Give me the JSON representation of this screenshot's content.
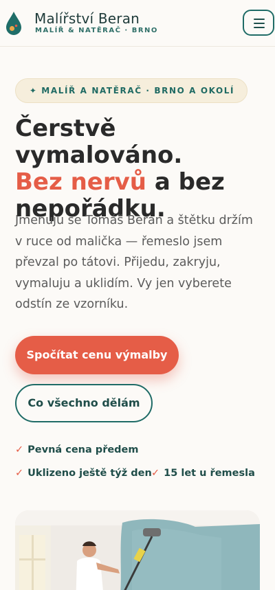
{
  "header": {
    "brand_name": "Malířství Beran",
    "brand_sub": "MALÍŘ & NATĚRAČ · BRNO",
    "menu_icon": "hamburger-icon"
  },
  "hero": {
    "pill": "✦ MALÍŘ A NATĚRAČ · BRNO A OKOLÍ",
    "title_line1": "Čerstvě vymalováno.",
    "title_accent": "Bez nervů",
    "title_rest": " a bez",
    "title_line3": "nepořádku.",
    "text": "Jmenuju se Tomáš Beran a štětku držím v ruce od malička — řemeslo jsem převzal po tátovi. Přijedu, zakryju, vymaluju a uklidím. Vy jen vyberete odstín ze vzorníku.",
    "primary_button": "Spočítat cenu výmalby",
    "secondary_button": "Co všechno dělám"
  },
  "perks": [
    "Pevná cena předem",
    "Uklizeno ještě týž den",
    "15 let u řemesla"
  ],
  "colors": {
    "accent": "#e55d47",
    "brand": "#1e6b66",
    "background": "#fcfaf7"
  }
}
